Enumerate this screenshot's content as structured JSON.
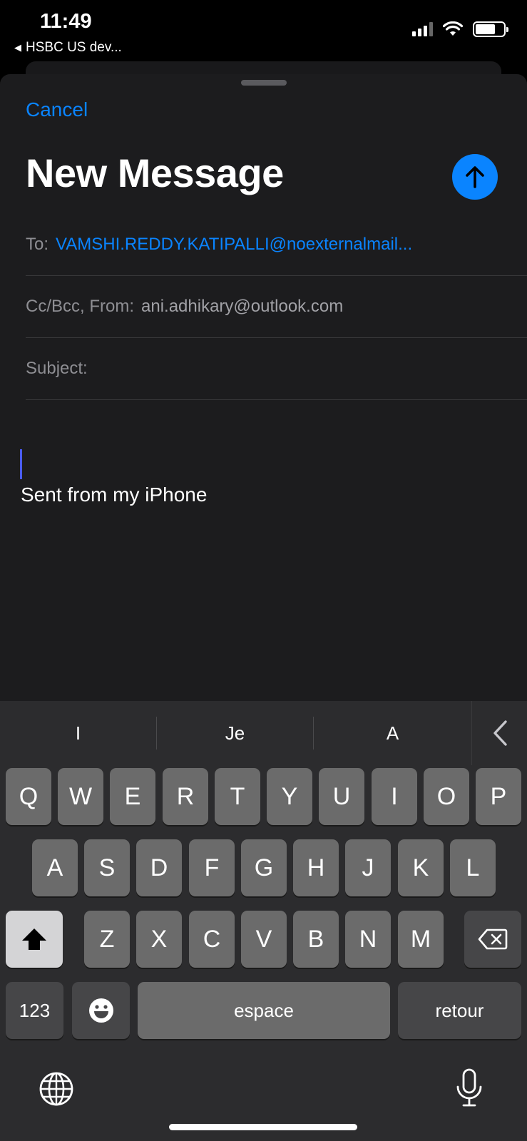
{
  "status": {
    "time": "11:49",
    "back_app": "HSBC US dev..."
  },
  "compose": {
    "cancel_label": "Cancel",
    "title": "New Message",
    "to_label": "To:",
    "to_value": "VAMSHI.REDDY.KATIPALLI@noexternalmail...",
    "cc_label": "Cc/Bcc, From:",
    "from_value": "ani.adhikary@outlook.com",
    "subject_label": "Subject:",
    "body_signature": "Sent from my iPhone"
  },
  "keyboard": {
    "suggestions": [
      "I",
      "Je",
      "A"
    ],
    "row1": [
      "Q",
      "W",
      "E",
      "R",
      "T",
      "Y",
      "U",
      "I",
      "O",
      "P"
    ],
    "row2": [
      "A",
      "S",
      "D",
      "F",
      "G",
      "H",
      "J",
      "K",
      "L"
    ],
    "row3": [
      "Z",
      "X",
      "C",
      "V",
      "B",
      "N",
      "M"
    ],
    "numbers_label": "123",
    "space_label": "espace",
    "return_label": "retour"
  },
  "colors": {
    "accent": "#0a84ff",
    "sheet_bg": "#1c1c1e",
    "keyboard_bg": "#2c2c2e"
  }
}
